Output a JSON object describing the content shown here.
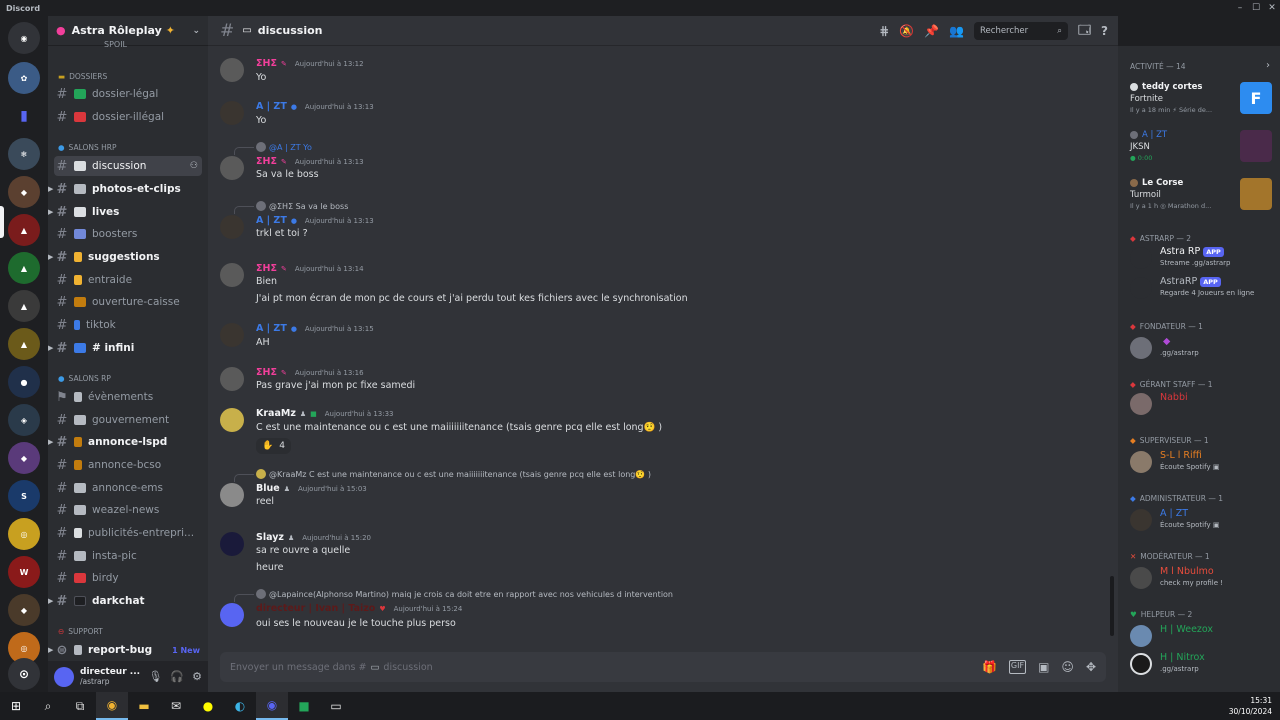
{
  "window": {
    "app_name": "Discord"
  },
  "server": {
    "name": "Astra Rôleplay",
    "spoiler_top": "spoil"
  },
  "categories": {
    "dossiers": "DOSSIERS",
    "salons_hrp": "SALONS HRP",
    "salons_rp": "SALONS RP",
    "support": "SUPPORT"
  },
  "channels": [
    {
      "name": "dossier-légal",
      "emoji_color": "#23a559"
    },
    {
      "name": "dossier-illégal",
      "emoji_color": "#da373c"
    },
    {
      "name": "discussion",
      "emoji_color": "#dbdee1"
    },
    {
      "name": "photos-et-clips",
      "emoji_color": "#b5bac1"
    },
    {
      "name": "lives",
      "emoji_color": "#dbdee1"
    },
    {
      "name": "boosters",
      "emoji_color": "#7289da"
    },
    {
      "name": "suggestions",
      "emoji_color": "#f0b232"
    },
    {
      "name": "entraide",
      "emoji_color": "#f0b232"
    },
    {
      "name": "ouverture-caisse",
      "emoji_color": "#c27c0e"
    },
    {
      "name": "tiktok",
      "emoji_color": "#3c7ae6"
    },
    {
      "name": "# infini",
      "emoji_color": "#3c7ae6"
    },
    {
      "name": "évènements",
      "emoji_color": "#b5bac1"
    },
    {
      "name": "gouvernement",
      "emoji_color": "#b5bac1"
    },
    {
      "name": "annonce-lspd",
      "emoji_color": "#c27c0e"
    },
    {
      "name": "annonce-bcso",
      "emoji_color": "#c27c0e"
    },
    {
      "name": "annonce-ems",
      "emoji_color": "#b5bac1"
    },
    {
      "name": "weazel-news",
      "emoji_color": "#b5bac1"
    },
    {
      "name": "publicités-entrepri...",
      "emoji_color": "#dbdee1"
    },
    {
      "name": "insta-pic",
      "emoji_color": "#b5bac1"
    },
    {
      "name": "birdy",
      "emoji_color": "#da373c"
    },
    {
      "name": "darkchat",
      "emoji_color": "#1e1f22"
    },
    {
      "name": "report-bug",
      "emoji_color": "#b5bac1"
    }
  ],
  "new_badge": "1 New",
  "user_panel": {
    "name": "directeur ...",
    "sub": "/astrarp"
  },
  "topbar": {
    "channel": "discussion",
    "search_placeholder": "Rechercher"
  },
  "messages": [
    {
      "author": "ΣΗΣ",
      "time": "Aujourd'hui à 13:12",
      "text": "Yo",
      "author_color": "#f23f9b"
    },
    {
      "author": "A | ZT",
      "time": "Aujourd'hui à 13:13",
      "text": "Yo",
      "author_color": "#3c7ae6"
    },
    {
      "reply": "@A | ZT Yo",
      "author": "ΣΗΣ",
      "time": "Aujourd'hui à 13:13",
      "text": "Sa va le boss",
      "author_color": "#f23f9b"
    },
    {
      "reply": "@ΣΗΣ Sa va le boss",
      "author": "A | ZT",
      "time": "Aujourd'hui à 13:13",
      "text": "trkl et toi ?",
      "author_color": "#3c7ae6"
    },
    {
      "author": "ΣΗΣ",
      "time": "Aujourd'hui à 13:14",
      "text": "Bien",
      "text2": "J'ai pt mon écran de mon pc de cours et j'ai perdu tout kes fichiers avec le synchronisation",
      "author_color": "#f23f9b"
    },
    {
      "author": "A | ZT",
      "time": "Aujourd'hui à 13:15",
      "text": "AH",
      "author_color": "#3c7ae6"
    },
    {
      "author": "ΣΗΣ",
      "time": "Aujourd'hui à 13:16",
      "text": "Pas grave j'ai mon pc fixe samedi",
      "author_color": "#f23f9b"
    },
    {
      "author": "KraaMz",
      "time": "Aujourd'hui à 13:33",
      "text": "C est une maintenance ou c est une maiiiiiiitenance (tsais genre pcq elle est long🤨 )",
      "reaction": "4",
      "author_color": "#f2f3f5"
    },
    {
      "reply": "@KraaMz C est une maintenance ou c est une maiiiiiiitenance (tsais genre pcq elle est long🤨 )",
      "author": "Blue",
      "time": "Aujourd'hui à 15:03",
      "text": "reel",
      "author_color": "#f2f3f5"
    },
    {
      "author": "Slayz",
      "time": "Aujourd'hui à 15:20",
      "text": "sa re ouvre a quelle",
      "text2": "heure",
      "author_color": "#f2f3f5"
    },
    {
      "reply": "@Lapaince(Alphonso Martino) maiq je crois ca doit etre en rapport avec nos vehicules d intervention",
      "author": "directeur | Ivan | Taizo",
      "time": "Aujourd'hui à 15:24",
      "text": "oui ses le nouveau je le touche plus perso",
      "author_color": "#5c1a1a"
    }
  ],
  "composer": {
    "placeholder": "Envoyer un message dans #",
    "channel": "discussion"
  },
  "activity": {
    "header": "ACTIVITÉ — 14",
    "items": [
      {
        "name": "teddy cortes",
        "game": "Fortnite",
        "detail": "Il y a 18 min  ⚡ Série de...",
        "thumb": "#2d8cf0",
        "thumb_text": "F"
      },
      {
        "name": "A | ZT",
        "game": "JKSN",
        "detail": "0:00",
        "thumb": "#4a2a4a"
      },
      {
        "name": "Le Corse",
        "game": "Turmoil",
        "detail": "Il y a 1 h  ◎ Marathon d...",
        "thumb": "#a3752b"
      }
    ]
  },
  "members": [
    {
      "cat": "ASTRARP — 2",
      "cat_color": "#da373c",
      "list": [
        {
          "name": "Astra RP",
          "app": "APP",
          "status": "Streame .gg/astrarp",
          "color": "#f2f3f5"
        },
        {
          "name": "AstraRP",
          "app": "APP",
          "status": "Regarde 4 Joueurs en ligne",
          "color": "#b5bac1"
        }
      ]
    },
    {
      "cat": "FONDATEUR — 1",
      "cat_color": "#da373c",
      "list": [
        {
          "name": "",
          "status": ".gg/astrarp",
          "color": "#8b1d1d"
        }
      ]
    },
    {
      "cat": "GÉRANT STAFF — 1",
      "cat_color": "#da373c",
      "list": [
        {
          "name": "Nabbi",
          "status": "",
          "color": "#da373c"
        }
      ]
    },
    {
      "cat": "SUPERVISEUR — 1",
      "cat_color": "#e67e22",
      "list": [
        {
          "name": "S-L l Riffi",
          "status": "Écoute Spotify",
          "color": "#e67e22"
        }
      ]
    },
    {
      "cat": "ADMINISTRATEUR — 1",
      "cat_color": "#3c7ae6",
      "list": [
        {
          "name": "A | ZT",
          "status": "Écoute Spotify",
          "color": "#3c7ae6"
        }
      ]
    },
    {
      "cat": "MODÉRATEUR — 1",
      "cat_color": "#e74c3c",
      "list": [
        {
          "name": "M l Nbulmo",
          "status": "check my profile !",
          "color": "#e74c3c"
        }
      ]
    },
    {
      "cat": "HELPEUR — 2",
      "cat_color": "#23a559",
      "list": [
        {
          "name": "H | Weezox",
          "status": "",
          "color": "#23a559"
        },
        {
          "name": "H | Nitrox",
          "status": ".gg/astrarp",
          "color": "#23a559"
        }
      ]
    }
  ],
  "clock": {
    "time": "15:31",
    "date": "30/10/2024"
  }
}
